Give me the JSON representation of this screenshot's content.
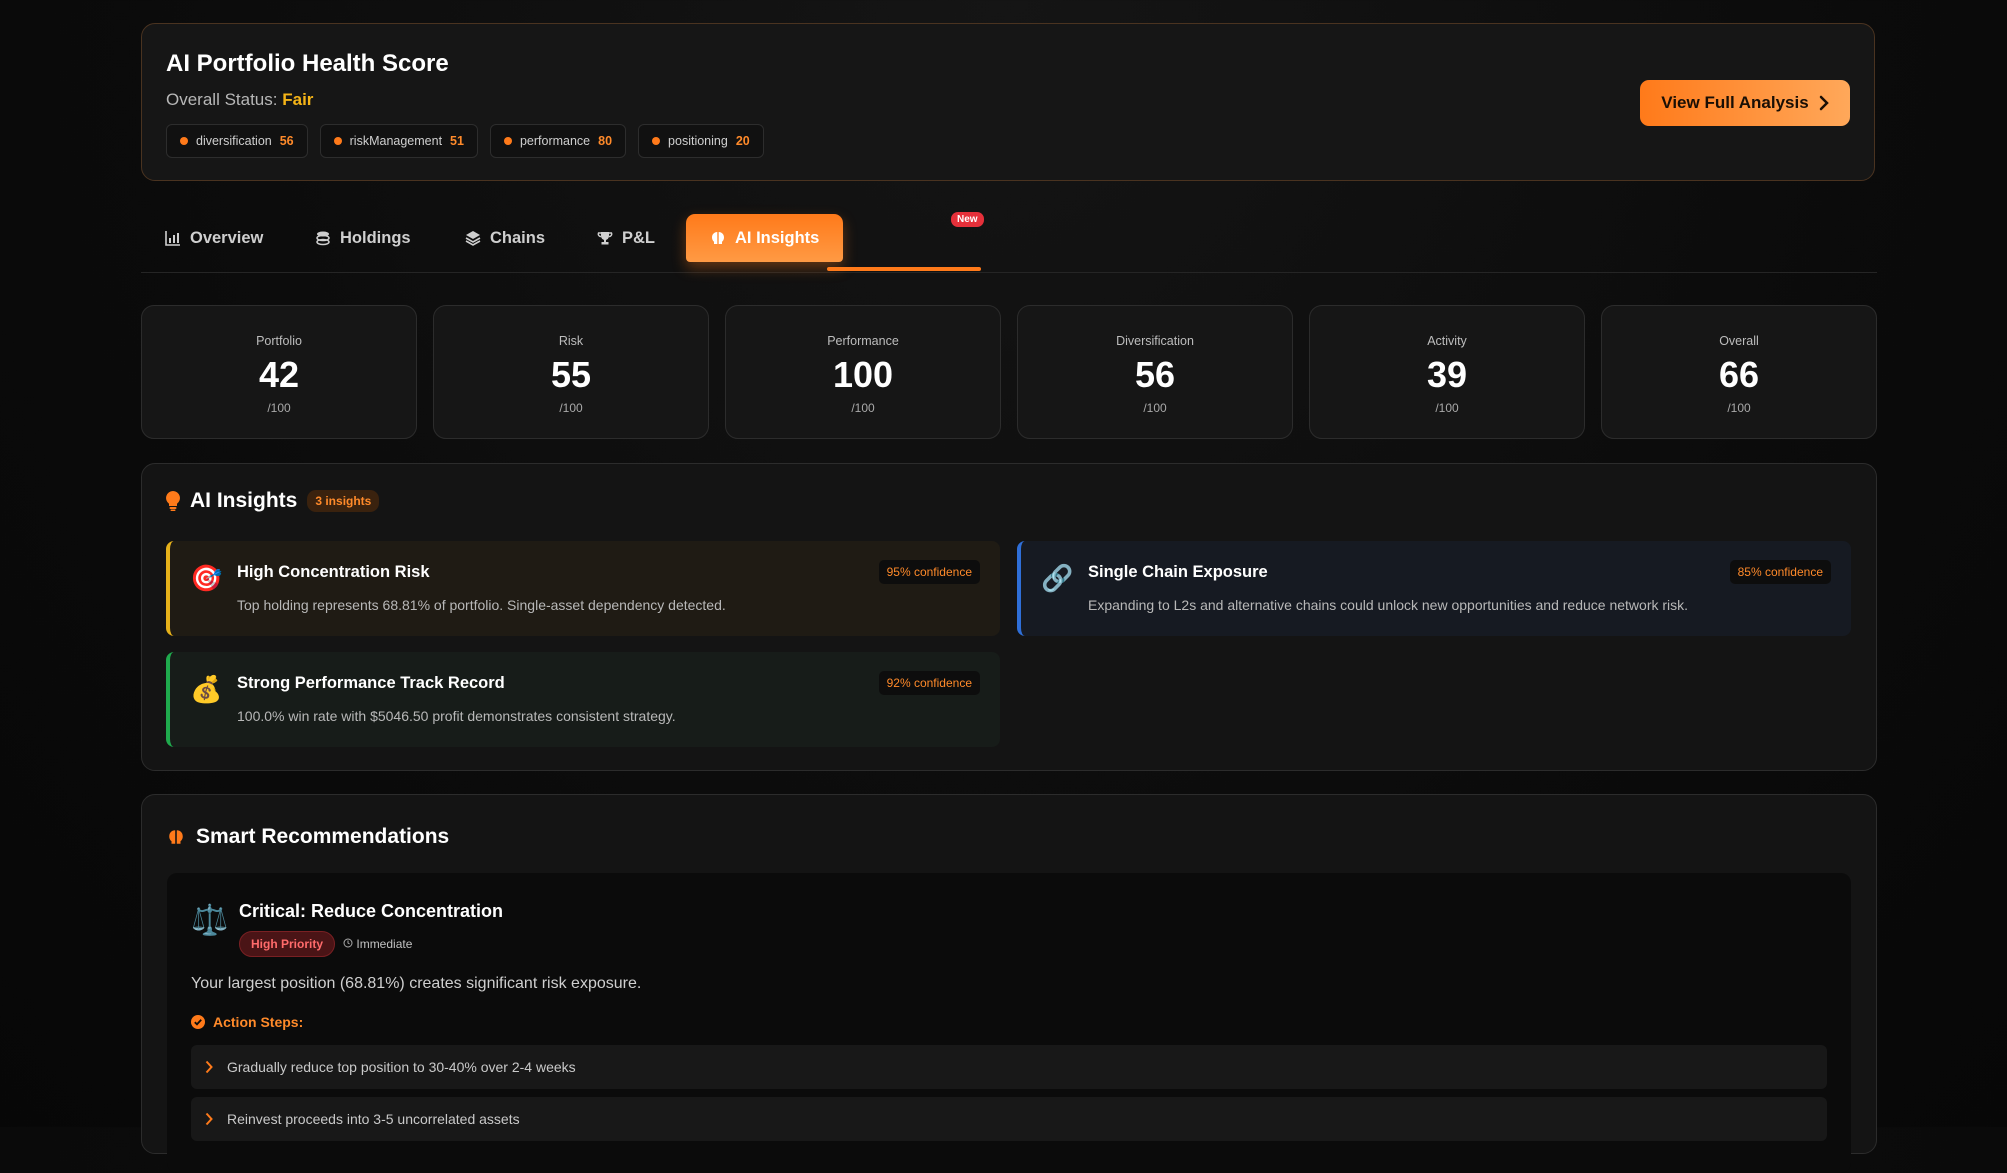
{
  "header": {
    "title": "AI Portfolio Health Score",
    "status_label": "Overall Status:",
    "status_value": "Fair",
    "chips": [
      {
        "label": "diversification",
        "value": "56"
      },
      {
        "label": "riskManagement",
        "value": "51"
      },
      {
        "label": "performance",
        "value": "80"
      },
      {
        "label": "positioning",
        "value": "20"
      }
    ],
    "cta_label": "View Full Analysis"
  },
  "tabs": [
    {
      "label": "Overview",
      "icon": "bar-chart-icon"
    },
    {
      "label": "Holdings",
      "icon": "coins-icon"
    },
    {
      "label": "Chains",
      "icon": "layers-icon"
    },
    {
      "label": "P&L",
      "icon": "trophy-icon"
    },
    {
      "label": "AI Insights",
      "icon": "brain-icon",
      "active": true,
      "badge": "New"
    }
  ],
  "scores": [
    {
      "label": "Portfolio",
      "value": "42",
      "max": "/100"
    },
    {
      "label": "Risk",
      "value": "55",
      "max": "/100"
    },
    {
      "label": "Performance",
      "value": "100",
      "max": "/100"
    },
    {
      "label": "Diversification",
      "value": "56",
      "max": "/100"
    },
    {
      "label": "Activity",
      "value": "39",
      "max": "/100"
    },
    {
      "label": "Overall",
      "value": "66",
      "max": "/100"
    }
  ],
  "insights": {
    "title": "AI Insights",
    "count": "3 insights",
    "items": [
      {
        "emoji": "🎯",
        "title": "High Concentration Risk",
        "desc": "Top holding represents 68.81% of portfolio. Single-asset dependency detected.",
        "confidence": "95% confidence",
        "accent": "#e6b11a"
      },
      {
        "emoji": "🔗",
        "title": "Single Chain Exposure",
        "desc": "Expanding to L2s and alternative chains could unlock new opportunities and reduce network risk.",
        "confidence": "85% confidence",
        "accent": "#2f6fd8"
      },
      {
        "emoji": "💰",
        "title": "Strong Performance Track Record",
        "desc": "100.0% win rate with $5046.50 profit demonstrates consistent strategy.",
        "confidence": "92% confidence",
        "accent": "#1faa4d"
      }
    ]
  },
  "recommendations": {
    "title": "Smart Recommendations",
    "card": {
      "icon": "⚖️",
      "title": "Critical: Reduce Concentration",
      "priority": "High Priority",
      "timeframe": "Immediate",
      "desc": "Your largest position (68.81%) creates significant risk exposure.",
      "steps_title": "Action Steps:",
      "steps": [
        "Gradually reduce top position to 30-40% over 2-4 weeks",
        "Reinvest proceeds into 3-5 uncorrelated assets"
      ]
    }
  },
  "colors": {
    "accent": "#ff7a1a",
    "status_fair": "#f5b417",
    "danger": "#e5303a"
  }
}
